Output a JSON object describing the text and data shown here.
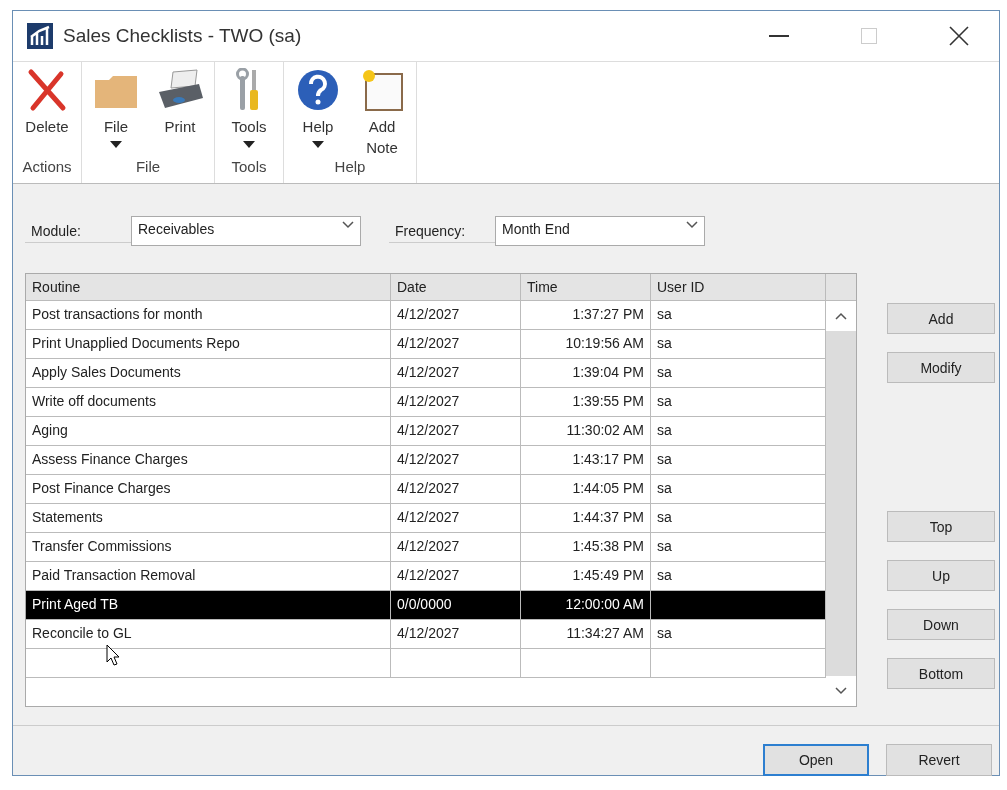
{
  "window": {
    "title": "Sales Checklists  -  TWO (sa)"
  },
  "ribbon": {
    "groups": [
      {
        "label": "Actions",
        "buttons": [
          {
            "kind": "delete",
            "label": "Delete",
            "dropdown": false
          }
        ]
      },
      {
        "label": "File",
        "buttons": [
          {
            "kind": "folder",
            "label": "File",
            "dropdown": true
          },
          {
            "kind": "printer",
            "label": "Print",
            "dropdown": false
          }
        ]
      },
      {
        "label": "Tools",
        "buttons": [
          {
            "kind": "tools",
            "label": "Tools",
            "dropdown": true
          }
        ]
      },
      {
        "label": "Help",
        "buttons": [
          {
            "kind": "help",
            "label": "Help",
            "dropdown": true
          },
          {
            "kind": "note",
            "label": "Add Note",
            "dropdown": false
          }
        ]
      }
    ]
  },
  "filters": [
    {
      "label": "Module:",
      "value": "Receivables"
    },
    {
      "label": "Frequency:",
      "value": "Month End"
    }
  ],
  "table": {
    "columns": [
      "Routine",
      "Date",
      "Time",
      "User ID"
    ],
    "rows": [
      {
        "cells": [
          "Post transactions for month",
          "4/12/2027",
          "1:37:27 PM",
          "sa"
        ],
        "selected": false
      },
      {
        "cells": [
          "Print Unapplied Documents Repo",
          "4/12/2027",
          "10:19:56 AM",
          "sa"
        ],
        "selected": false
      },
      {
        "cells": [
          "Apply Sales Documents",
          "4/12/2027",
          "1:39:04 PM",
          "sa"
        ],
        "selected": false
      },
      {
        "cells": [
          "Write off documents",
          "4/12/2027",
          "1:39:55 PM",
          "sa"
        ],
        "selected": false
      },
      {
        "cells": [
          "Aging",
          "4/12/2027",
          "11:30:02 AM",
          "sa"
        ],
        "selected": false
      },
      {
        "cells": [
          "Assess Finance Charges",
          "4/12/2027",
          "1:43:17 PM",
          "sa"
        ],
        "selected": false
      },
      {
        "cells": [
          "Post Finance Charges",
          "4/12/2027",
          "1:44:05 PM",
          "sa"
        ],
        "selected": false
      },
      {
        "cells": [
          "Statements",
          "4/12/2027",
          "1:44:37 PM",
          "sa"
        ],
        "selected": false
      },
      {
        "cells": [
          "Transfer Commissions",
          "4/12/2027",
          "1:45:38 PM",
          "sa"
        ],
        "selected": false
      },
      {
        "cells": [
          "Paid Transaction Removal",
          "4/12/2027",
          "1:45:49 PM",
          "sa"
        ],
        "selected": false
      },
      {
        "cells": [
          "Print Aged TB",
          "0/0/0000",
          "12:00:00 AM"
        ],
        "selected": true
      },
      {
        "cells": [
          "Reconcile to GL",
          "4/12/2027",
          "11:34:27 AM",
          "sa"
        ],
        "selected": false
      }
    ]
  },
  "edit_buttons": [
    "Add",
    "Modify"
  ],
  "move_buttons": [
    "Top",
    "Up",
    "Down",
    "Bottom"
  ],
  "footer_buttons": [
    {
      "label": "Open",
      "default": true
    },
    {
      "label": "Revert",
      "default": false
    }
  ]
}
